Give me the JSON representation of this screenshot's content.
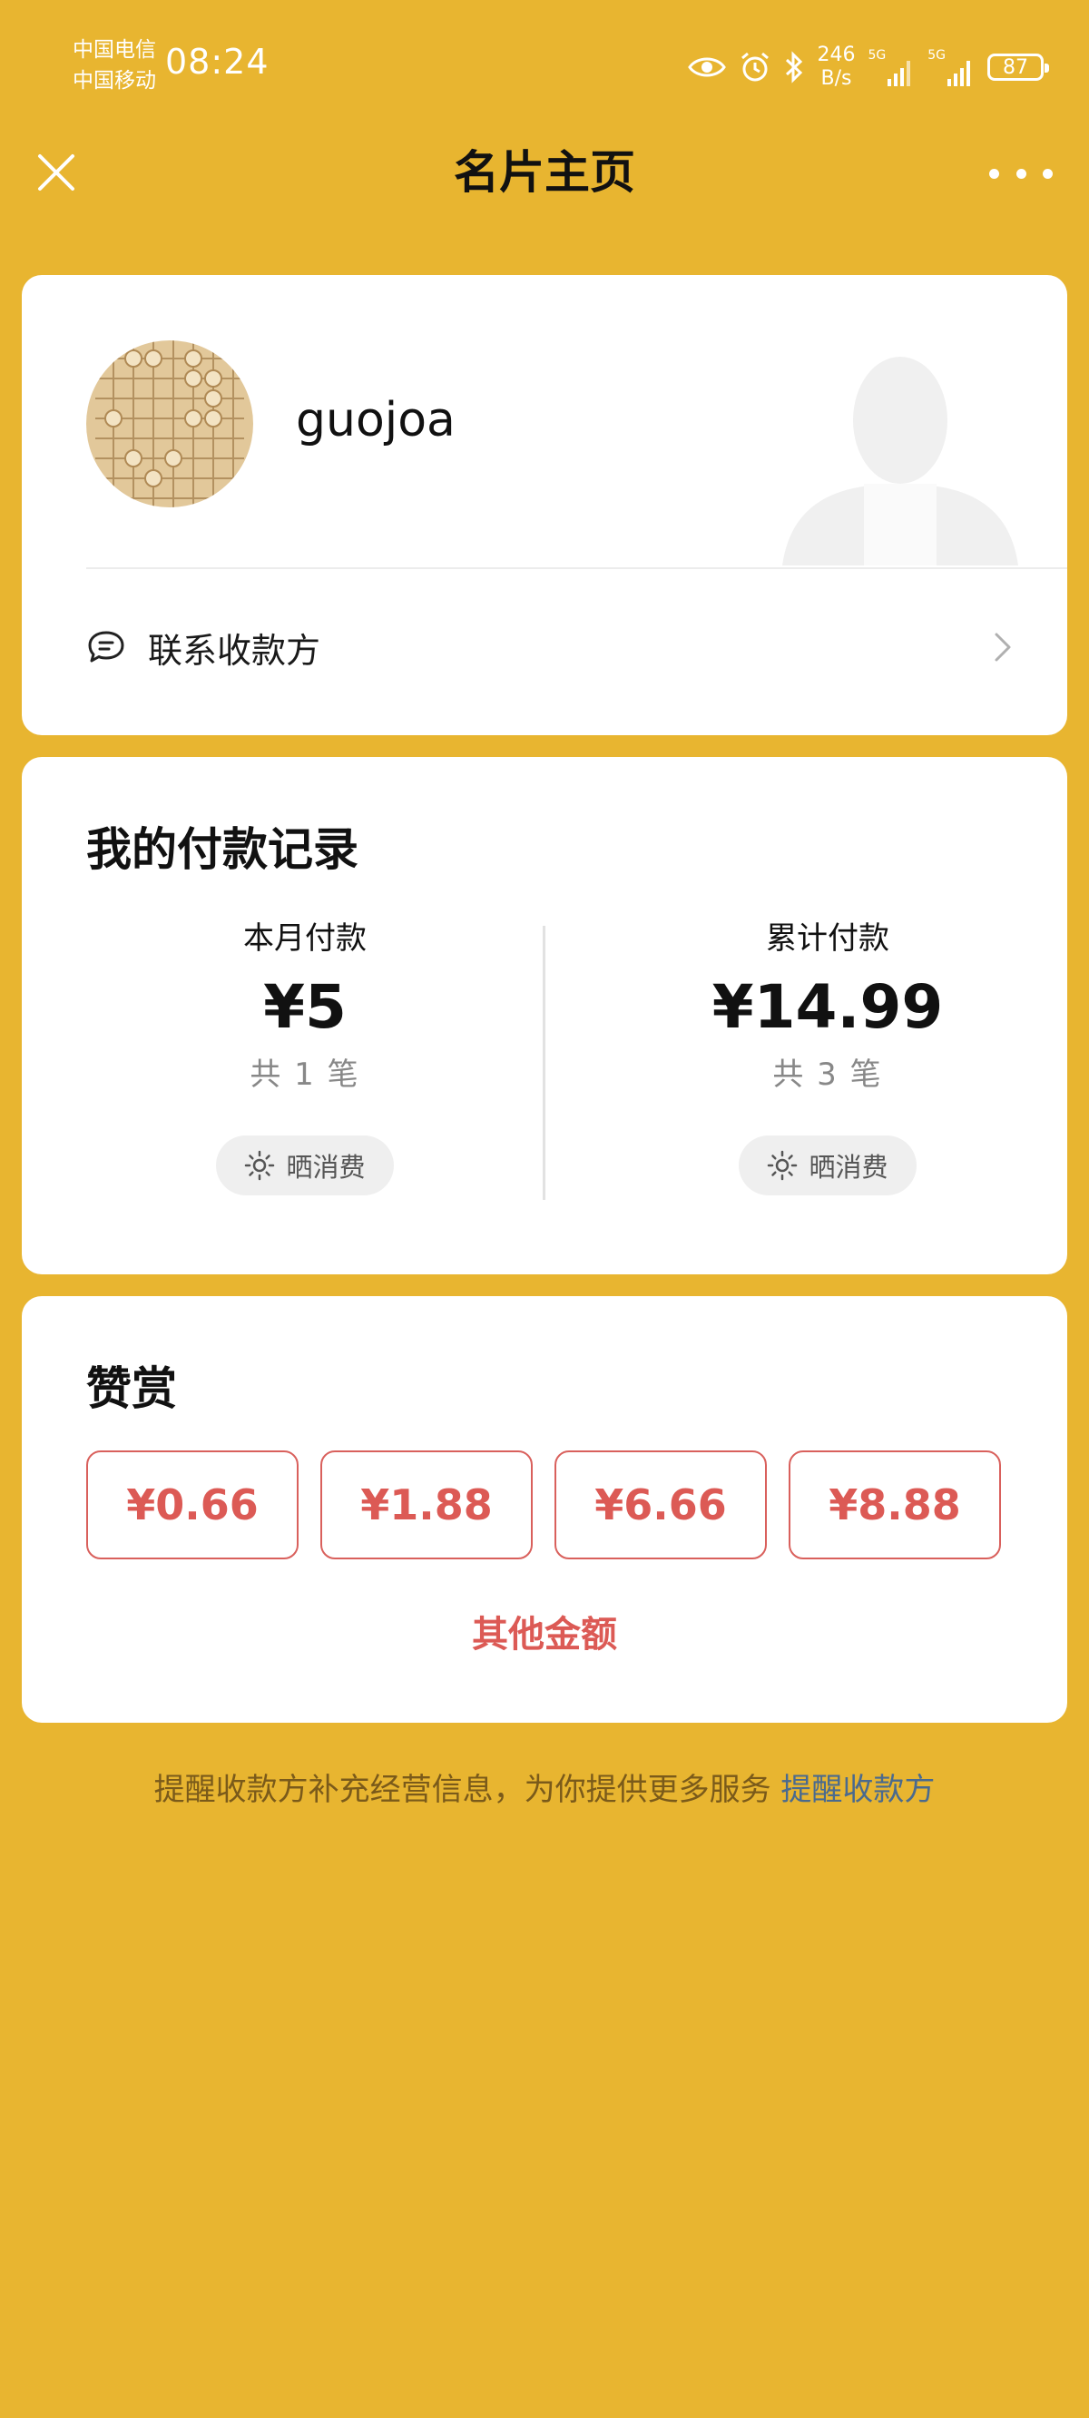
{
  "status_bar": {
    "carrier_1": "中国电信",
    "carrier_2": "中国移动",
    "time": "08:24",
    "net_speed_value": "246",
    "net_speed_unit": "B/s",
    "signal_1_label": "5G",
    "signal_2_label": "5G",
    "battery": "87"
  },
  "nav": {
    "title": "名片主页"
  },
  "profile": {
    "username": "guojoa",
    "contact_label": "联系收款方"
  },
  "payments": {
    "title": "我的付款记录",
    "this_month": {
      "label": "本月付款",
      "amount": "¥5",
      "count": "共 1 笔",
      "share_label": "晒消费"
    },
    "total": {
      "label": "累计付款",
      "amount": "¥14.99",
      "count": "共 3 笔",
      "share_label": "晒消费"
    }
  },
  "reward": {
    "title": "赞赏",
    "amounts": [
      "¥0.66",
      "¥1.88",
      "¥6.66",
      "¥8.88"
    ],
    "other_label": "其他金额"
  },
  "footer": {
    "note": "提醒收款方补充经营信息，为你提供更多服务",
    "link": "提醒收款方"
  },
  "colors": {
    "background": "#E8B530",
    "accent_red": "#DC5A55",
    "link_blue": "#4A6A8E"
  }
}
